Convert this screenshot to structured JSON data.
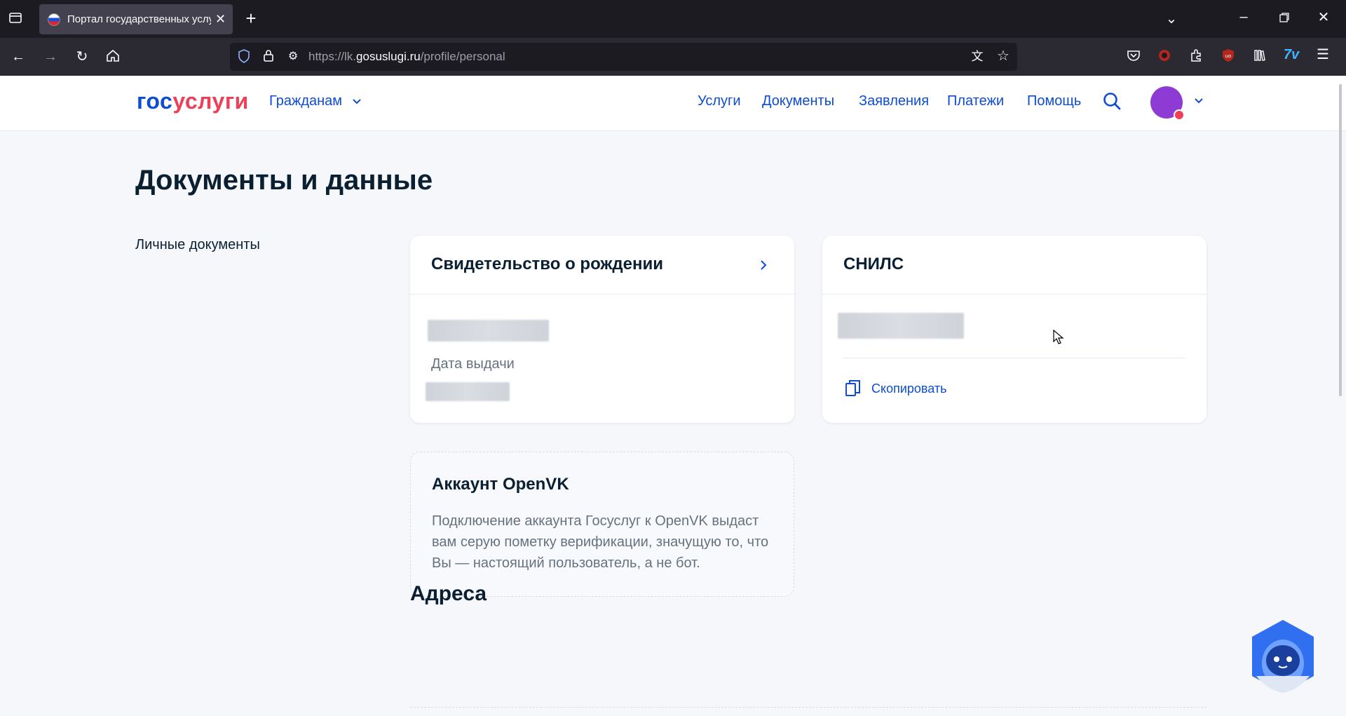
{
  "browser": {
    "tab_title": "Портал государственных услуг",
    "url_prefix": "https://lk.",
    "url_host": "gosuslugi.ru",
    "url_path": "/profile/personal"
  },
  "header": {
    "logo_part1": "гос",
    "logo_part2": "услуги",
    "citizens_label": "Гражданам",
    "nav": [
      "Услуги",
      "Документы",
      "Заявления",
      "Платежи",
      "Помощь"
    ]
  },
  "main": {
    "title": "Документы и данные",
    "side_label": "Личные документы",
    "birth_cert": {
      "title": "Свидетельство о рождении",
      "issue_date_label": "Дата выдачи"
    },
    "snils": {
      "title": "СНИЛС",
      "copy_label": "Скопировать"
    },
    "openvk": {
      "title": "Аккаунт OpenVK",
      "description": "Подключение аккаунта Госуслуг к OpenVK выдаст вам серую пометку верификации, значущую то, что Вы — настоящий пользователь, а не бот."
    },
    "addresses_title": "Адреса"
  },
  "colors": {
    "brand_blue": "#0d4cd3",
    "brand_red": "#ee3f58",
    "text": "#0b1f33",
    "muted": "#66727f"
  }
}
